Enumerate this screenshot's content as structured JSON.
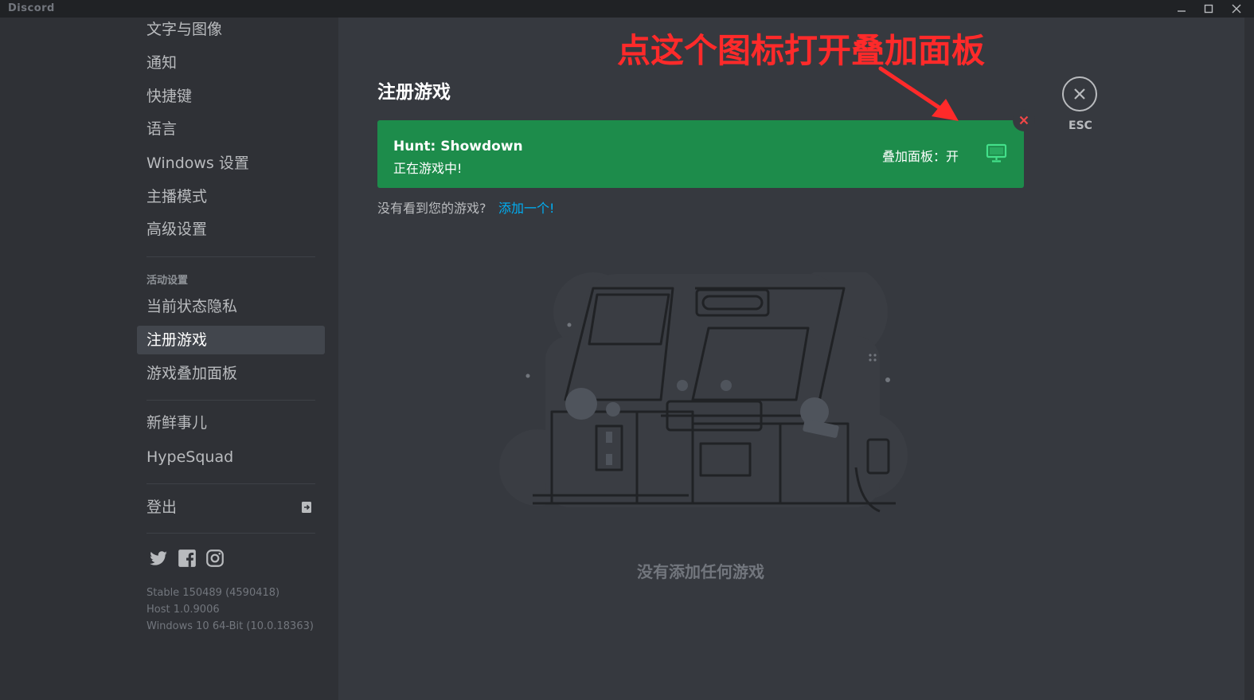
{
  "window": {
    "app_title": "Discord",
    "controls": [
      "minimize-icon",
      "maximize-icon",
      "close-icon"
    ]
  },
  "sidebar": {
    "items_top": [
      {
        "label": "文字与图像"
      },
      {
        "label": "通知"
      },
      {
        "label": "快捷键"
      },
      {
        "label": "语言"
      },
      {
        "label": "Windows 设置"
      },
      {
        "label": "主播模式"
      },
      {
        "label": "高级设置"
      }
    ],
    "activity_header": "活动设置",
    "activity_items": [
      {
        "label": "当前状态隐私"
      },
      {
        "label": "注册游戏",
        "selected": true
      },
      {
        "label": "游戏叠加面板"
      }
    ],
    "misc_items": [
      {
        "label": "新鲜事儿"
      },
      {
        "label": "HypeSquad"
      }
    ],
    "logout": {
      "label": "登出",
      "icon": "logout-icon"
    },
    "social_icons": [
      "twitter-icon",
      "facebook-icon",
      "instagram-icon"
    ],
    "version": {
      "line1": "Stable 150489 (4590418)",
      "line2": "Host 1.0.9006",
      "line3": "Windows 10 64-Bit (10.0.18363)"
    }
  },
  "main": {
    "title": "注册游戏",
    "game": {
      "name": "Hunt: Showdown",
      "status": "正在游戏中!",
      "overlay_label": "叠加面板：",
      "overlay_value": "开",
      "overlay_icon": "monitor-icon",
      "remove_icon": "close-icon"
    },
    "not_seen_text": "没有看到您的游戏?",
    "add_link": "添加一个!",
    "empty_text": "没有添加任何游戏",
    "esc_label": "ESC",
    "accent_color": "#1d8c4b",
    "link_color": "#00aff4"
  },
  "annotation": {
    "text": "点这个图标打开叠加面板",
    "color": "#ff2a2a"
  }
}
